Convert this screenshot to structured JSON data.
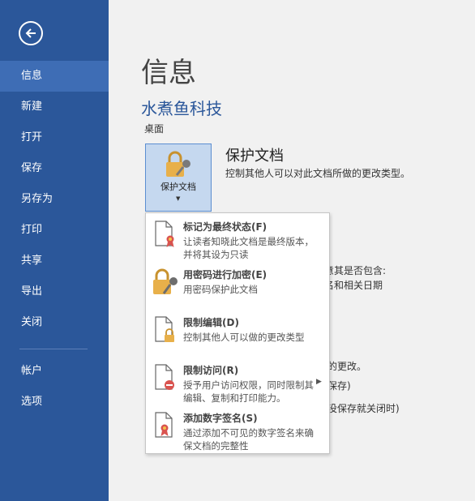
{
  "sidebar": {
    "items": [
      {
        "label": "信息"
      },
      {
        "label": "新建"
      },
      {
        "label": "打开"
      },
      {
        "label": "保存"
      },
      {
        "label": "另存为"
      },
      {
        "label": "打印"
      },
      {
        "label": "共享"
      },
      {
        "label": "导出"
      },
      {
        "label": "关闭"
      },
      {
        "label": "帐户"
      },
      {
        "label": "选项"
      }
    ],
    "active": "信息"
  },
  "main": {
    "title": "信息",
    "doc_name": "水煮鱼科技",
    "doc_location": "桌面",
    "protect": {
      "button_label": "保护文档",
      "title": "保护文档",
      "description": "控制其他人可以对此文档所做的更改类型。"
    },
    "partial_texts": [
      "意其是否包含:",
      "名和相关日期",
      "的更改。",
      "保存)",
      "没保存就关闭时)"
    ]
  },
  "menu": {
    "items": [
      {
        "title": "标记为最终状态(F)",
        "desc": "让读者知晓此文档是最终版本，并将其设为只读"
      },
      {
        "title": "用密码进行加密(E)",
        "desc": "用密码保护此文档"
      },
      {
        "title": "限制编辑(D)",
        "desc": "控制其他人可以做的更改类型"
      },
      {
        "title": "限制访问(R)",
        "desc": "授予用户访问权限，同时限制其编辑、复制和打印能力。"
      },
      {
        "title": "添加数字签名(S)",
        "desc": "通过添加不可见的数字签名来确保文档的完整性"
      }
    ]
  },
  "colors": {
    "sidebar_bg": "#2b579a",
    "sidebar_active": "#3e6db5",
    "accent": "#2b579a",
    "lock": "#e8b04a"
  }
}
